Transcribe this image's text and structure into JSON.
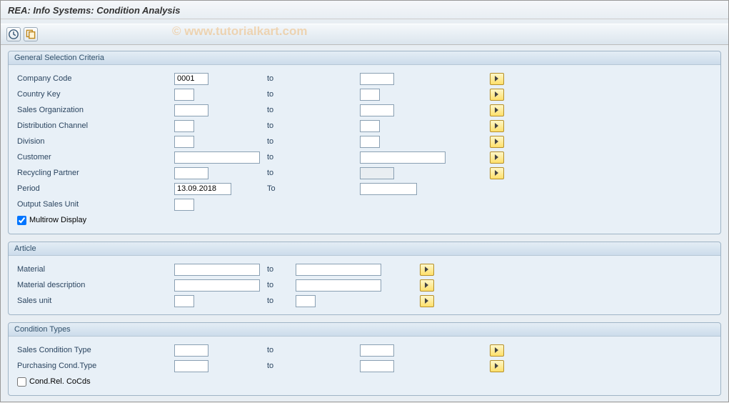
{
  "title": "REA: Info Systems: Condition Analysis",
  "watermark": "© www.tutorialkart.com",
  "toolbar": {
    "execute_icon": "execute",
    "variant_icon": "variant"
  },
  "groups": {
    "general": {
      "title": "General Selection Criteria",
      "company_code": {
        "label": "Company Code",
        "from": "0001",
        "to_label": "to",
        "to": ""
      },
      "country_key": {
        "label": "Country Key",
        "from": "",
        "to_label": "to",
        "to": ""
      },
      "sales_org": {
        "label": "Sales Organization",
        "from": "",
        "to_label": "to",
        "to": ""
      },
      "dist_channel": {
        "label": "Distribution Channel",
        "from": "",
        "to_label": "to",
        "to": ""
      },
      "division": {
        "label": "Division",
        "from": "",
        "to_label": "to",
        "to": ""
      },
      "customer": {
        "label": "Customer",
        "from": "",
        "to_label": "to",
        "to": ""
      },
      "recycling_partner": {
        "label": "Recycling Partner",
        "from": "",
        "to_label": "to",
        "to": ""
      },
      "period": {
        "label": "Period",
        "from": "13.09.2018",
        "to_label": "To",
        "to": ""
      },
      "output_sales_unit": {
        "label": "Output Sales Unit",
        "value": ""
      },
      "multirow": {
        "label": "Multirow Display",
        "checked": true
      }
    },
    "article": {
      "title": "Article",
      "material": {
        "label": "Material",
        "from": "",
        "to_label": "to",
        "to": ""
      },
      "material_desc": {
        "label": "Material description",
        "from": "",
        "to_label": "to",
        "to": ""
      },
      "sales_unit": {
        "label": "Sales unit",
        "from": "",
        "to_label": "to",
        "to": ""
      }
    },
    "condition_types": {
      "title": "Condition Types",
      "sales_cond": {
        "label": "Sales Condition Type",
        "from": "",
        "to_label": "to",
        "to": ""
      },
      "purch_cond": {
        "label": "Purchasing Cond.Type",
        "from": "",
        "to_label": "to",
        "to": ""
      },
      "cond_rel": {
        "label": "Cond.Rel. CoCds",
        "checked": false
      }
    }
  }
}
